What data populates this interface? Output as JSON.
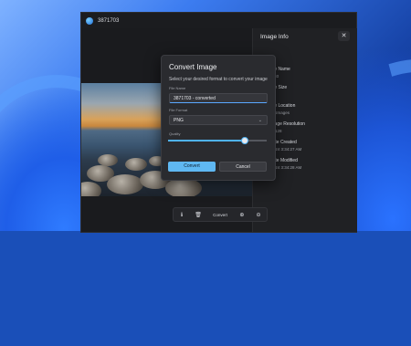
{
  "app": {
    "title": "3871703"
  },
  "info_panel": {
    "title": "Image Info",
    "close_glyph": "✕",
    "items": [
      {
        "label": "File Name",
        "value": "1703"
      },
      {
        "label": "File Size",
        "value": "B"
      },
      {
        "label": "File Location",
        "value": "ctu\\Images"
      },
      {
        "label": "Image Resolution",
        "value": "x 3128"
      },
      {
        "label": "Date Created",
        "value": "/2024 3:34:27 AM"
      },
      {
        "label": "Date Modified",
        "value": "/2024 3:34:28 AM"
      }
    ]
  },
  "dialog": {
    "title": "Convert Image",
    "subtitle": "Select your desired format to convert your image",
    "file_name_label": "File Name",
    "file_name_value": "3871703 - converted",
    "file_format_label": "File Format",
    "file_format_value": "PNG",
    "quality_label": "Quality",
    "quality_value": 0.78,
    "convert_label": "Convert",
    "cancel_label": "Cancel"
  },
  "toolbar": {
    "info_glyph": "ℹ",
    "delete_glyph": "🗑",
    "convert_label": "Convert",
    "zoom_in_glyph": "⊕",
    "zoom_out_glyph": "⊖"
  },
  "colors": {
    "accent": "#5fb8f2",
    "window_bg": "#1e1f22",
    "dialog_bg": "#2a2b2f"
  }
}
